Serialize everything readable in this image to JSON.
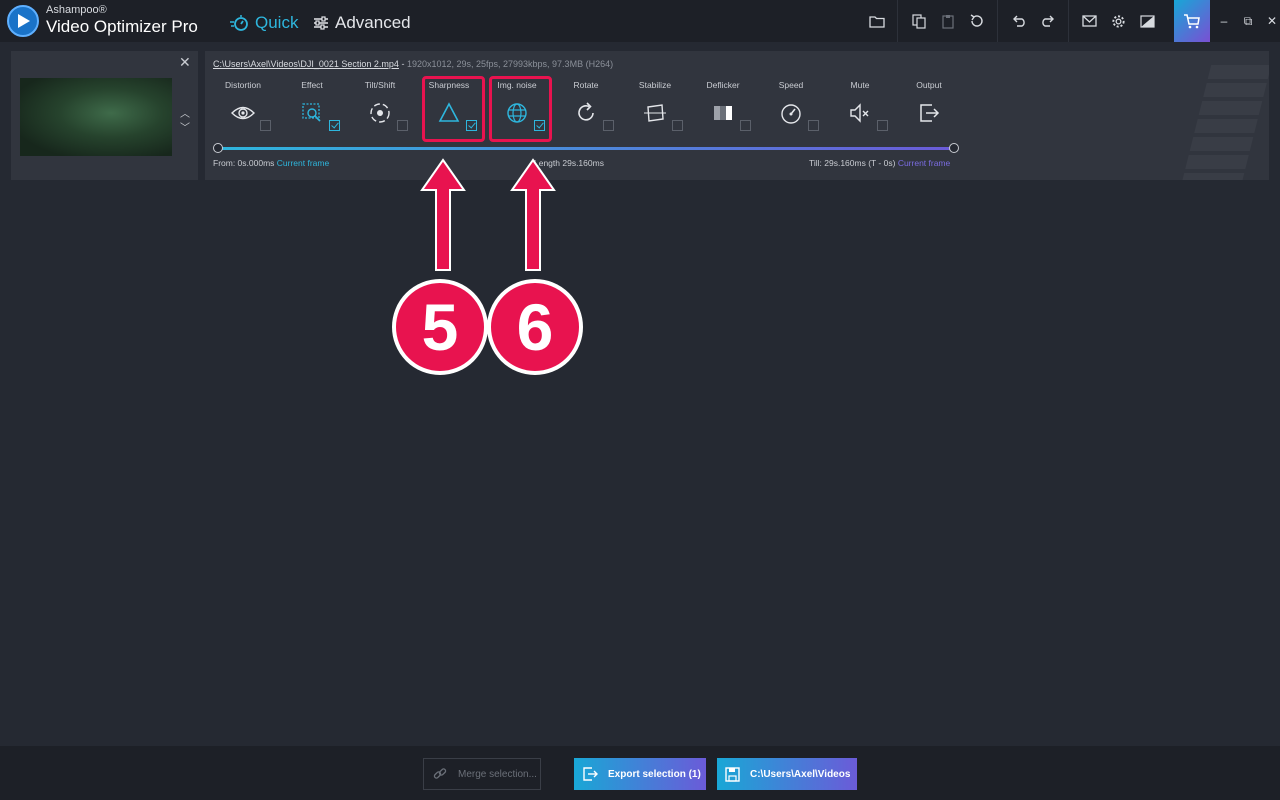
{
  "app": {
    "brand_small": "Ashampoo®",
    "brand_name": "Video Optimizer Pro"
  },
  "modes": {
    "quick": "Quick",
    "advanced": "Advanced"
  },
  "clip": {
    "file_path": "C:\\Users\\Axel\\Videos\\DJI_0021 Section 2.mp4",
    "separator": " - ",
    "meta": "1920x1012, 29s, 25fps, 27993kbps, 97.3MB (H264)"
  },
  "tools": [
    {
      "label": "Distortion",
      "icon": "eye-icon",
      "checked": false
    },
    {
      "label": "Effect",
      "icon": "effect-icon",
      "checked": true
    },
    {
      "label": "Tilt/Shift",
      "icon": "tiltshift-icon",
      "checked": false
    },
    {
      "label": "Sharpness",
      "icon": "triangle-icon",
      "checked": true
    },
    {
      "label": "Img. noise",
      "icon": "globe-icon",
      "checked": true
    },
    {
      "label": "Rotate",
      "icon": "rotate-icon",
      "checked": false
    },
    {
      "label": "Stabilize",
      "icon": "stabilize-icon",
      "checked": false
    },
    {
      "label": "Deflicker",
      "icon": "deflicker-icon",
      "checked": false
    },
    {
      "label": "Speed",
      "icon": "speedometer-icon",
      "checked": false
    },
    {
      "label": "Mute",
      "icon": "mute-icon",
      "checked": false
    },
    {
      "label": "Output",
      "icon": "output-icon",
      "checked": false
    }
  ],
  "timeline": {
    "from_label": "From: 0s.000ms",
    "from_link": "Current frame",
    "length_label": "Length 29s.160ms",
    "till_label": "Till: 29s.160ms (T - 0s)",
    "till_link": "Current frame"
  },
  "annotations": {
    "badge_5": "5",
    "badge_6": "6"
  },
  "bottom": {
    "merge": "Merge selection...",
    "export": "Export selection (1)",
    "save_path": "C:\\Users\\Axel\\Videos"
  },
  "colors": {
    "accent": "#2eb6dd",
    "highlight": "#e8134f",
    "bg": "#252932"
  }
}
